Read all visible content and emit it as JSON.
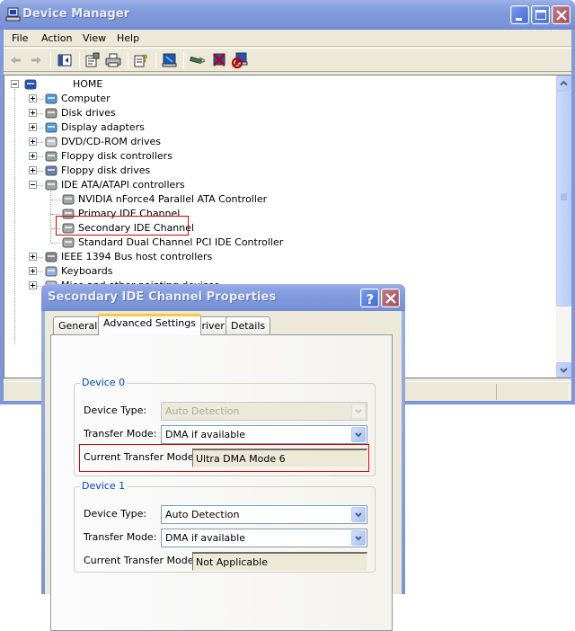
{
  "device_manager": {
    "title": "Device Manager",
    "menu": [
      "File",
      "Action",
      "View",
      "Help"
    ],
    "toolbar": [
      {
        "icon": "back-arrow-icon",
        "enabled": false
      },
      {
        "icon": "forward-arrow-icon",
        "enabled": false
      },
      {
        "icon": "show-hide-console-tree-icon",
        "enabled": true
      },
      {
        "icon": "properties-icon",
        "enabled": true
      },
      {
        "icon": "print-icon",
        "enabled": true
      },
      {
        "icon": "help-icon",
        "enabled": true
      },
      {
        "icon": "scan-hardware-changes-icon",
        "enabled": true
      },
      {
        "icon": "update-driver-icon",
        "enabled": true
      },
      {
        "icon": "uninstall-icon",
        "enabled": true
      },
      {
        "icon": "disable-device-icon",
        "enabled": true
      }
    ],
    "tree": {
      "root": {
        "label": "HOME",
        "expanded": true,
        "icon": "computer-icon"
      },
      "categories": [
        {
          "label": "Computer",
          "expanded": false,
          "icon": "computer-category-icon"
        },
        {
          "label": "Disk drives",
          "expanded": false,
          "icon": "disk-drive-icon"
        },
        {
          "label": "Display adapters",
          "expanded": false,
          "icon": "display-adapter-icon"
        },
        {
          "label": "DVD/CD-ROM drives",
          "expanded": false,
          "icon": "dvd-drive-icon"
        },
        {
          "label": "Floppy disk controllers",
          "expanded": false,
          "icon": "floppy-controller-icon"
        },
        {
          "label": "Floppy disk drives",
          "expanded": false,
          "icon": "floppy-drive-icon"
        },
        {
          "label": "IDE ATA/ATAPI controllers",
          "expanded": true,
          "icon": "ide-controller-icon",
          "children": [
            {
              "label": "NVIDIA nForce4 Parallel ATA Controller",
              "highlighted": false
            },
            {
              "label": "Primary IDE Channel",
              "highlighted": false
            },
            {
              "label": "Secondary IDE Channel",
              "highlighted": true
            },
            {
              "label": "Standard Dual Channel PCI IDE Controller",
              "highlighted": false
            }
          ]
        },
        {
          "label": "IEEE 1394 Bus host controllers",
          "expanded": false,
          "icon": "ieee1394-icon"
        },
        {
          "label": "Keyboards",
          "expanded": false,
          "icon": "keyboard-icon"
        },
        {
          "label": "Mice and other pointing devices",
          "expanded": false,
          "icon": "mouse-icon"
        }
      ]
    }
  },
  "properties_dialog": {
    "title": "Secondary IDE Channel Properties",
    "tabs": [
      {
        "label": "General",
        "active": false
      },
      {
        "label": "Advanced Settings",
        "active": true
      },
      {
        "label": "Driver",
        "active": false
      },
      {
        "label": "Details",
        "active": false
      }
    ],
    "device0": {
      "group_label": "Device 0",
      "device_type_label": "Device Type:",
      "device_type_value": "Auto Detection",
      "device_type_enabled": false,
      "transfer_mode_label": "Transfer Mode:",
      "transfer_mode_value": "DMA if available",
      "current_mode_label": "Current Transfer Mode:",
      "current_mode_value": "Ultra DMA Mode 6",
      "highlighted": true
    },
    "device1": {
      "group_label": "Device 1",
      "device_type_label": "Device Type:",
      "device_type_value": "Auto Detection",
      "device_type_enabled": true,
      "transfer_mode_label": "Transfer Mode:",
      "transfer_mode_value": "DMA if available",
      "current_mode_label": "Current Transfer Mode:",
      "current_mode_value": "Not Applicable"
    }
  },
  "colors": {
    "highlight_box": "#e00000",
    "group_title": "#0046d5",
    "title_text": "#e9eef9"
  }
}
